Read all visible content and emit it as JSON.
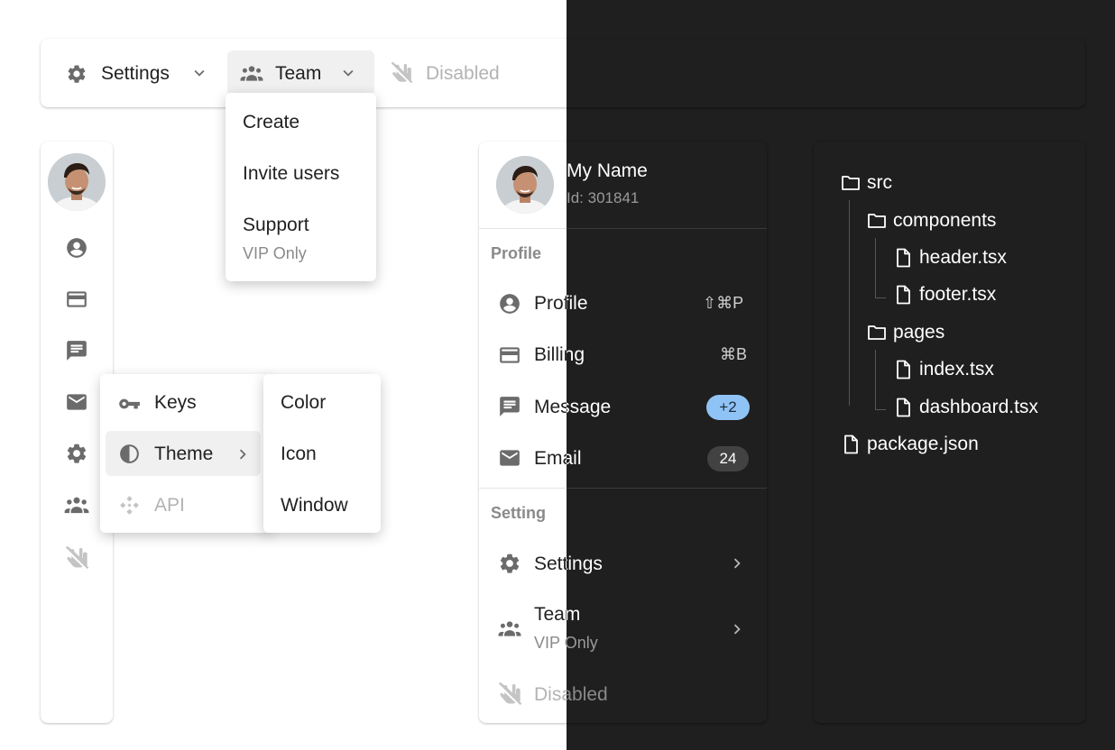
{
  "menubar": {
    "settings_label": "Settings",
    "team_label": "Team",
    "disabled_label": "Disabled"
  },
  "team_dropdown": {
    "items": [
      {
        "label": "Create"
      },
      {
        "label": "Invite users"
      },
      {
        "label": "Support",
        "sublabel": "VIP Only"
      }
    ]
  },
  "context_menu": {
    "items": [
      {
        "label": "Keys"
      },
      {
        "label": "Theme"
      },
      {
        "label": "API"
      }
    ],
    "submenu": [
      {
        "label": "Color"
      },
      {
        "label": "Icon"
      },
      {
        "label": "Window"
      }
    ]
  },
  "profile_panel": {
    "name": "My Name",
    "id_text": "Id: 301841",
    "section_profile": "Profile",
    "section_setting": "Setting",
    "items": [
      {
        "label": "Profile",
        "shortcut": "⇧⌘P"
      },
      {
        "label": "Billing",
        "shortcut": "⌘B"
      },
      {
        "label": "Message",
        "badge": "+2"
      },
      {
        "label": "Email",
        "badge": "24"
      },
      {
        "label": "Settings"
      },
      {
        "label": "Team",
        "sublabel": "VIP Only"
      },
      {
        "label": "Disabled"
      }
    ]
  },
  "file_tree": {
    "src": "src",
    "components": "components",
    "header": "header.tsx",
    "footer": "footer.tsx",
    "pages": "pages",
    "index": "index.tsx",
    "dashboard": "dashboard.tsx",
    "package": "package.json"
  },
  "colors": {
    "dark_background": "#1f1f1f",
    "message_badge": "#90c3f5",
    "email_badge_light": "#e0e0e0",
    "email_badge_dark": "#424242"
  }
}
